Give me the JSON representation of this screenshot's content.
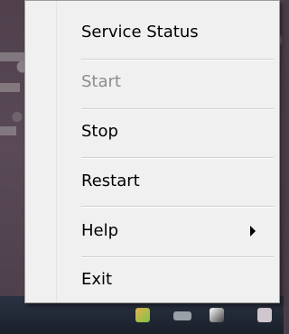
{
  "menu": {
    "items": [
      {
        "label": "Service Status",
        "enabled": true
      },
      {
        "label": "Start",
        "enabled": false
      },
      {
        "label": "Stop",
        "enabled": true
      },
      {
        "label": "Restart",
        "enabled": true
      },
      {
        "label": "Help",
        "enabled": true,
        "submenu": true
      },
      {
        "label": "Exit",
        "enabled": true
      }
    ]
  },
  "icons": {
    "submenu": "chevron-right-icon",
    "tray": [
      "service-tray-icon",
      "network-tray-icon",
      "volume-tray-icon",
      "system-tray-icon"
    ]
  },
  "colors": {
    "menu_background": "#f0f0f0",
    "disabled_text": "#8c8c8c",
    "taskbar": "#1a202a"
  }
}
